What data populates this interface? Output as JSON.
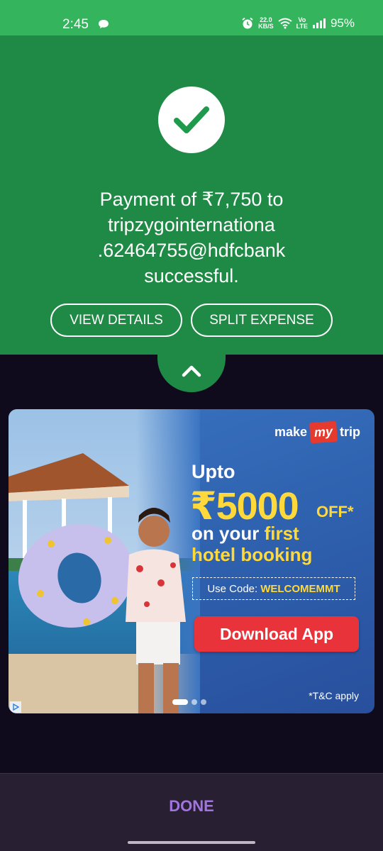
{
  "status_bar": {
    "time": "2:45",
    "net_speed_value": "22.0",
    "net_speed_unit": "KB/S",
    "volte_top": "Vo",
    "volte_bottom": "LTE",
    "battery": "95%"
  },
  "success": {
    "line1": "Payment of ₹7,750 to",
    "line2": "tripzygointernationa",
    "line3": ".62464755@hdfcbank",
    "line4": "successful.",
    "view_details_label": "VIEW DETAILS",
    "split_expense_label": "SPLIT EXPENSE"
  },
  "ad": {
    "brand_make": "make",
    "brand_my": "my",
    "brand_trip": "trip",
    "upto": "Upto",
    "amount": "₹5000",
    "off": "OFF*",
    "on_your": "on your",
    "first": "first",
    "hotel_booking": "hotel booking",
    "code_label": "Use Code:",
    "code_value": "WELCOMEMMT",
    "download_label": "Download App",
    "tc": "*T&C apply",
    "carousel_pages": 3,
    "carousel_active": 1
  },
  "footer": {
    "done_label": "DONE"
  },
  "colors": {
    "status_green": "#34b45c",
    "success_green": "#1f8a45",
    "dark_bg": "#0f0a1c",
    "done_purple": "#a274e0",
    "download_red": "#e8333a",
    "offer_yellow": "#ffd83a"
  },
  "icons": {
    "success": "check-icon",
    "collapse": "chevron-up-icon"
  }
}
